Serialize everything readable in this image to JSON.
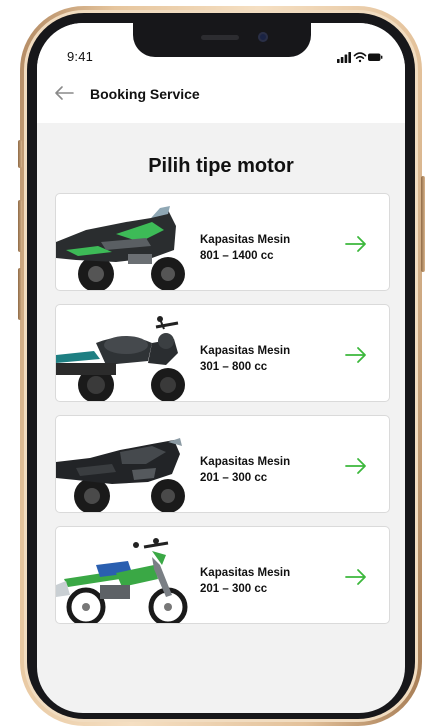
{
  "status_bar": {
    "time": "9:41",
    "icons": [
      "signal-icon",
      "wifi-icon",
      "battery-icon"
    ]
  },
  "header": {
    "back_icon": "arrow-left-icon",
    "title": "Booking Service"
  },
  "page": {
    "title": "Pilih tipe motor"
  },
  "cards": [
    {
      "label": "Kapasitas Mesin",
      "range": "801 – 1400 cc",
      "icon": "arrow-right-icon",
      "image": "motorcycle-sportbike-black-green"
    },
    {
      "label": "Kapasitas Mesin",
      "range": "301 – 800 cc",
      "icon": "arrow-right-icon",
      "image": "motorcycle-retro-black-teal-seat"
    },
    {
      "label": "Kapasitas Mesin",
      "range": "201 – 300 cc",
      "icon": "arrow-right-icon",
      "image": "motorcycle-sportbike-black"
    },
    {
      "label": "Kapasitas Mesin",
      "range": "201 – 300 cc",
      "icon": "arrow-right-icon",
      "image": "motorcycle-dirtbike-green"
    }
  ],
  "colors": {
    "accent": "#3cb83c",
    "frame_gold": "#e6c59d",
    "screen_bg": "#f2f2f2"
  }
}
